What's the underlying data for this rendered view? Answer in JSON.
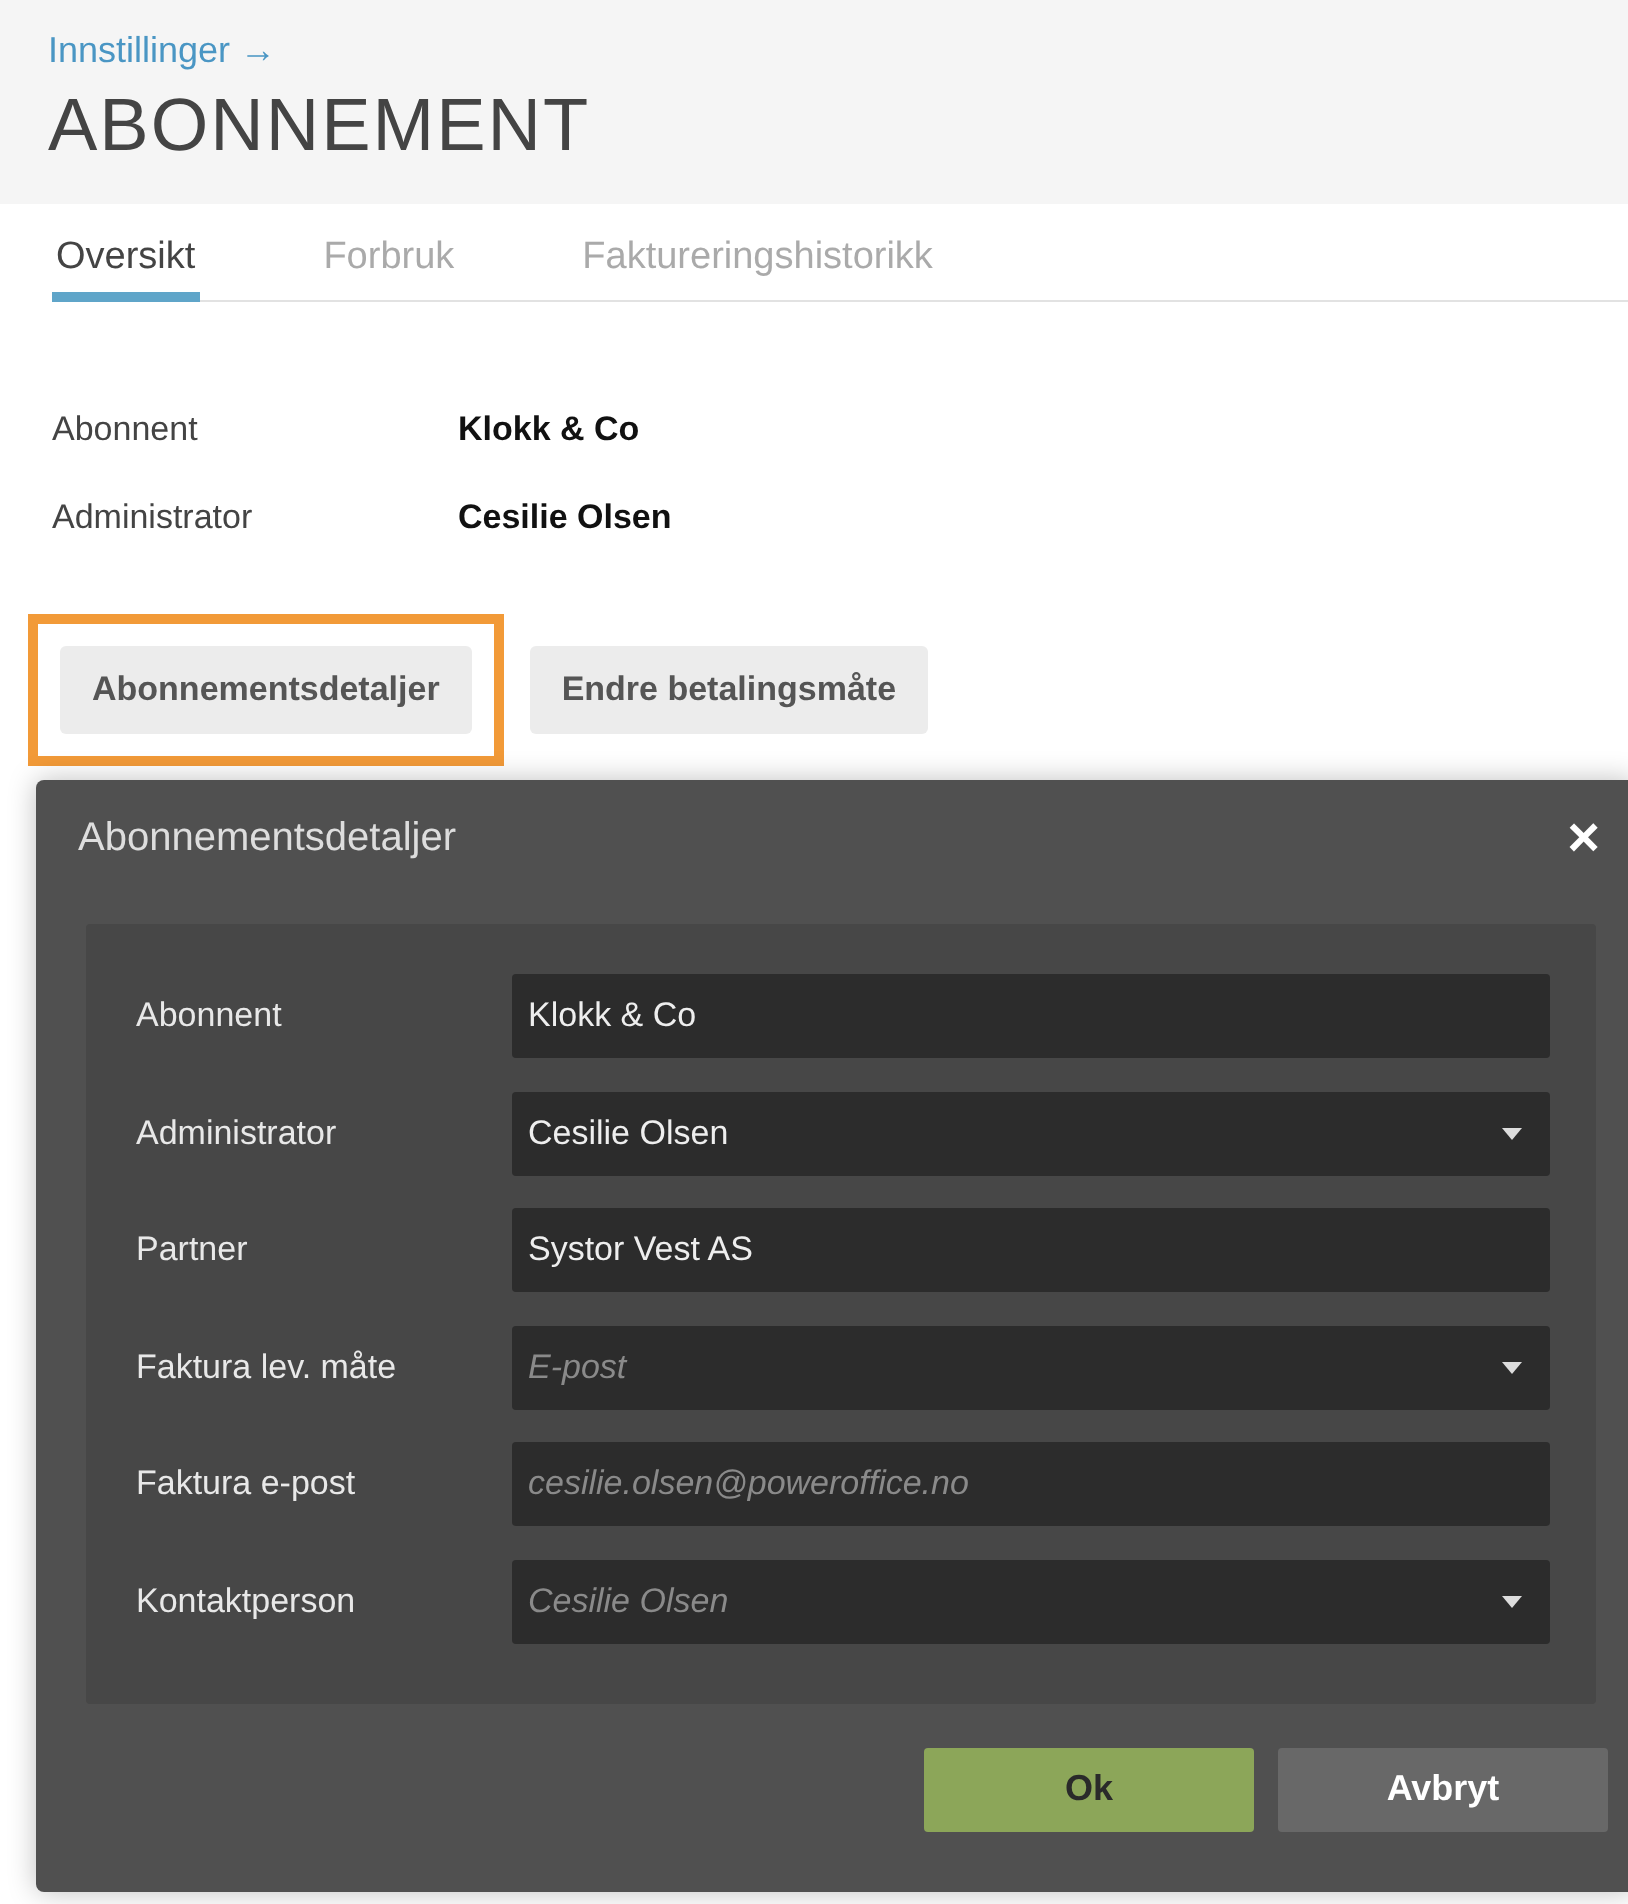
{
  "header": {
    "breadcrumb": "Innstillinger →",
    "title": "ABONNEMENT"
  },
  "tabs": [
    {
      "label": "Oversikt",
      "selected": true
    },
    {
      "label": "Forbruk",
      "selected": false
    },
    {
      "label": "Faktureringshistorikk",
      "selected": false
    }
  ],
  "info": [
    {
      "label": "Abonnent",
      "value": "Klokk & Co"
    },
    {
      "label": "Administrator",
      "value": "Cesilie Olsen"
    }
  ],
  "actions": [
    {
      "label": "Abonnementsdetaljer",
      "highlighted": true
    },
    {
      "label": "Endre betalingsmåte",
      "highlighted": false
    }
  ],
  "dialog": {
    "title": "Abonnementsdetaljer",
    "close": "×",
    "fields": [
      {
        "label": "Abonnent",
        "kind": "text",
        "value": "Klokk & Co"
      },
      {
        "label": "Administrator",
        "kind": "select",
        "value": "Cesilie Olsen"
      },
      {
        "label": "Partner",
        "kind": "text",
        "value": "Systor Vest AS"
      },
      {
        "label": "Faktura lev. måte",
        "kind": "select",
        "placeholder": "E-post"
      },
      {
        "label": "Faktura e-post",
        "kind": "text",
        "placeholder": "cesilie.olsen@poweroffice.no"
      },
      {
        "label": "Kontaktperson",
        "kind": "select",
        "placeholder": "Cesilie Olsen"
      }
    ],
    "buttons": [
      {
        "label": "Ok",
        "kind": "primary"
      },
      {
        "label": "Avbryt",
        "kind": "secondary"
      }
    ]
  }
}
